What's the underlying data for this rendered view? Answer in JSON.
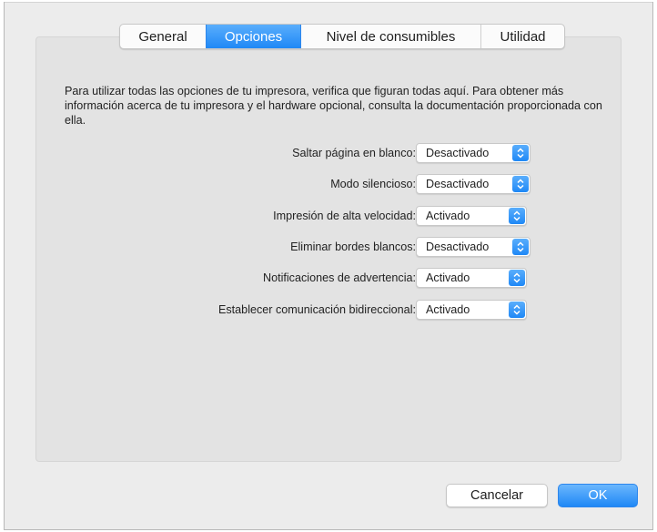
{
  "tabs": [
    {
      "label": "General",
      "active": false
    },
    {
      "label": "Opciones",
      "active": true
    },
    {
      "label": "Nivel de consumibles",
      "active": false
    },
    {
      "label": "Utilidad",
      "active": false
    }
  ],
  "description": "Para utilizar todas las opciones de tu impresora, verifica que figuran todas aquí. Para obtener más información acerca de tu impresora y el hardware opcional, consulta la documentación proporcionada con ella.",
  "options": [
    {
      "label": "Saltar página en blanco:",
      "value": "Desactivado"
    },
    {
      "label": "Modo silencioso:",
      "value": "Desactivado"
    },
    {
      "label": "Impresión de alta velocidad:",
      "value": "Activado"
    },
    {
      "label": "Eliminar bordes blancos:",
      "value": "Desactivado"
    },
    {
      "label": "Notificaciones de advertencia:",
      "value": "Activado"
    },
    {
      "label": "Establecer comunicación bidireccional:",
      "value": "Activado"
    }
  ],
  "buttons": {
    "cancel": "Cancelar",
    "ok": "OK"
  },
  "colors": {
    "accent": "#1f88f6",
    "panel_background": "#e3e3e3",
    "window_background": "#ececec"
  },
  "icons": {
    "popup_arrows": "up-down-chevron-icon"
  }
}
